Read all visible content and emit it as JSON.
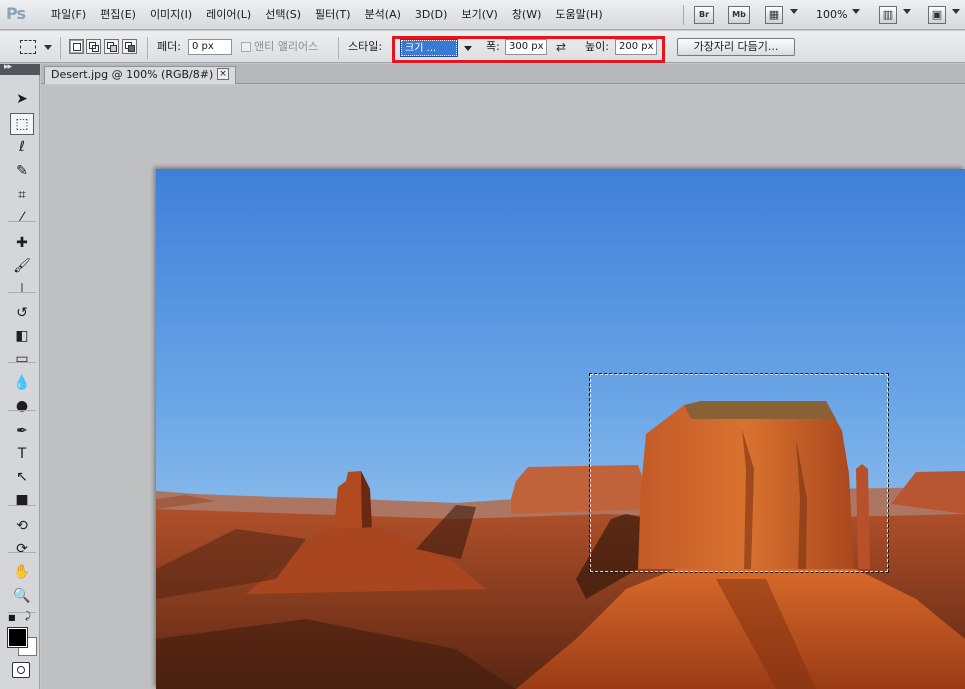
{
  "app": {
    "logo": "Ps",
    "menu": [
      "파일(F)",
      "편집(E)",
      "이미지(I)",
      "레이어(L)",
      "선택(S)",
      "필터(T)",
      "분석(A)",
      "3D(D)",
      "보기(V)",
      "창(W)",
      "도움말(H)"
    ],
    "bridge_label": "Br",
    "minibridge_label": "Mb",
    "zoom": "100%"
  },
  "options": {
    "feather_label": "페더:",
    "feather_value": "0 px",
    "antialias_label": "앤티 앨리어스",
    "style_label": "스타일:",
    "style_value": "크기 ...",
    "width_label": "폭:",
    "width_value": "300 px",
    "height_label": "높이:",
    "height_value": "200 px",
    "refine_edge_label": "가장자리 다듬기..."
  },
  "tools": {
    "header_glyph": "▸▸",
    "items": [
      {
        "name": "move-tool",
        "glyph": "➤"
      },
      {
        "name": "rectangular-marquee-tool",
        "glyph": "⬚",
        "active": true
      },
      {
        "name": "lasso-tool",
        "glyph": "ℓ"
      },
      {
        "name": "quick-selection-tool",
        "glyph": "✎"
      },
      {
        "name": "crop-tool",
        "glyph": "⌗"
      },
      {
        "name": "eyedropper-tool",
        "glyph": "⁄"
      },
      {
        "name": "healing-brush-tool",
        "glyph": "✚"
      },
      {
        "name": "brush-tool",
        "glyph": "🖌"
      },
      {
        "name": "clone-stamp-tool",
        "glyph": "⊥"
      },
      {
        "name": "history-brush-tool",
        "glyph": "↺"
      },
      {
        "name": "eraser-tool",
        "glyph": "◧"
      },
      {
        "name": "gradient-tool",
        "glyph": "▭"
      },
      {
        "name": "blur-tool",
        "glyph": "💧"
      },
      {
        "name": "dodge-tool",
        "glyph": "●"
      },
      {
        "name": "pen-tool",
        "glyph": "✒"
      },
      {
        "name": "type-tool",
        "glyph": "T"
      },
      {
        "name": "path-selection-tool",
        "glyph": "↖"
      },
      {
        "name": "shape-tool",
        "glyph": "■"
      },
      {
        "name": "3d-rotate-tool",
        "glyph": "⟲"
      },
      {
        "name": "3d-orbit-tool",
        "glyph": "⟳"
      },
      {
        "name": "hand-tool",
        "glyph": "✋"
      },
      {
        "name": "zoom-tool",
        "glyph": "🔍"
      }
    ],
    "default_colors_glyph": "■",
    "swap_colors_glyph": "⤸"
  },
  "document": {
    "tab_title": "Desert.jpg @ 100% (RGB/8#) *",
    "close_glyph": "×"
  },
  "colors": {
    "highlight": "#e8141d",
    "foreground": "#000000",
    "background": "#ffffff"
  }
}
